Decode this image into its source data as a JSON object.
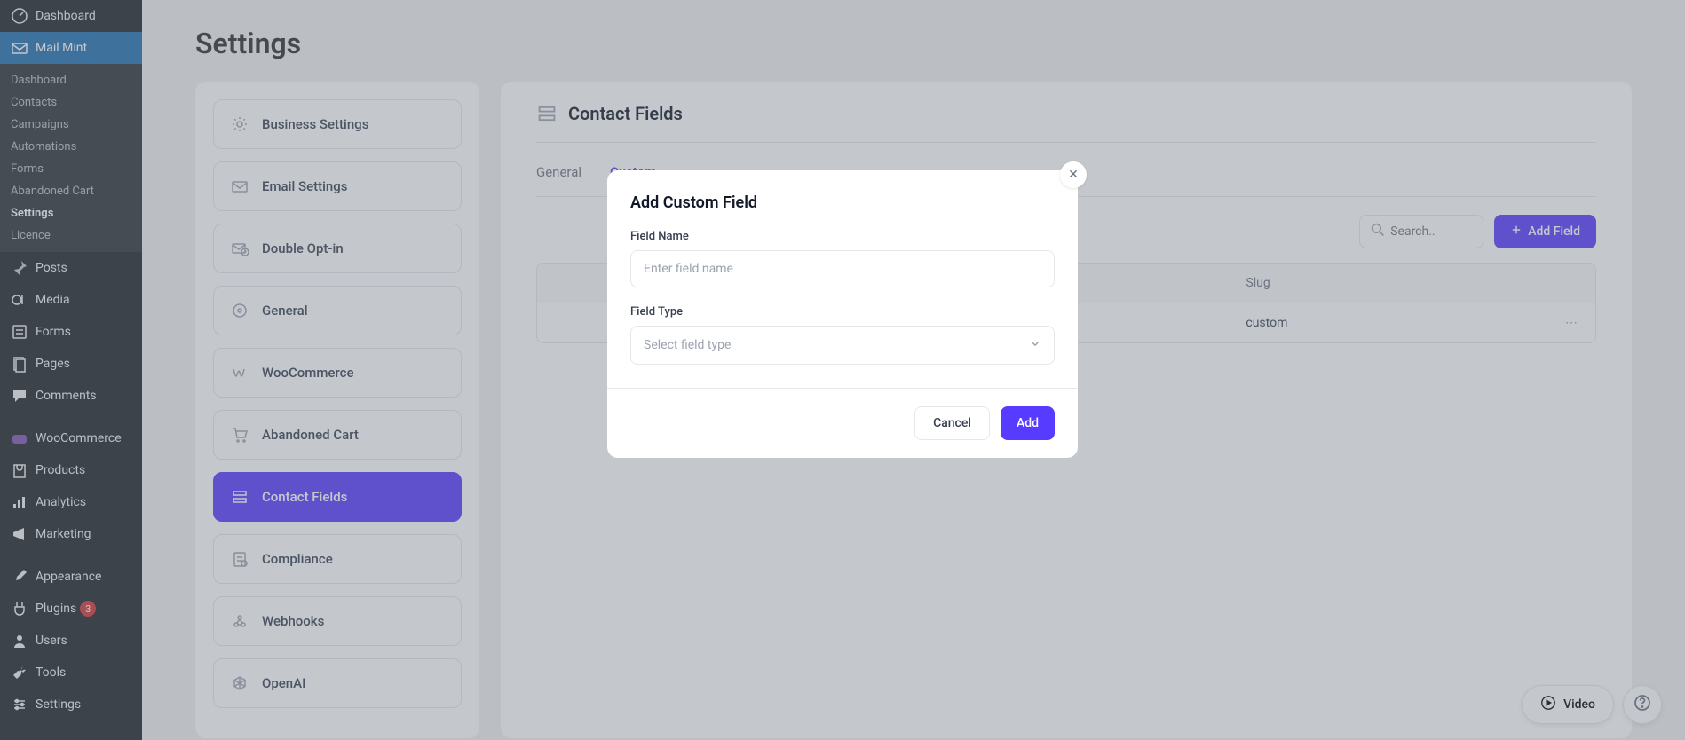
{
  "sidebar": {
    "main": [
      {
        "label": "Dashboard",
        "icon": "dashboard"
      },
      {
        "label": "Mail Mint",
        "icon": "mail",
        "active": true
      }
    ],
    "sub": [
      {
        "label": "Dashboard"
      },
      {
        "label": "Contacts"
      },
      {
        "label": "Campaigns"
      },
      {
        "label": "Automations"
      },
      {
        "label": "Forms"
      },
      {
        "label": "Abandoned Cart"
      },
      {
        "label": "Settings",
        "active": true
      },
      {
        "label": "Licence"
      }
    ],
    "bottom": [
      {
        "label": "Posts",
        "icon": "pin"
      },
      {
        "label": "Media",
        "icon": "media"
      },
      {
        "label": "Forms",
        "icon": "forms"
      },
      {
        "label": "Pages",
        "icon": "page"
      },
      {
        "label": "Comments",
        "icon": "comment"
      },
      {
        "label": "WooCommerce",
        "icon": "woo"
      },
      {
        "label": "Products",
        "icon": "product"
      },
      {
        "label": "Analytics",
        "icon": "analytics"
      },
      {
        "label": "Marketing",
        "icon": "marketing"
      },
      {
        "label": "Appearance",
        "icon": "brush"
      },
      {
        "label": "Plugins",
        "icon": "plugin",
        "badge": "3"
      },
      {
        "label": "Users",
        "icon": "user"
      },
      {
        "label": "Tools",
        "icon": "tool"
      },
      {
        "label": "Settings",
        "icon": "settings"
      }
    ]
  },
  "page": {
    "title": "Settings"
  },
  "settingsNav": [
    {
      "label": "Business Settings",
      "icon": "gear"
    },
    {
      "label": "Email Settings",
      "icon": "mail"
    },
    {
      "label": "Double Opt-in",
      "icon": "checkmail"
    },
    {
      "label": "General",
      "icon": "general"
    },
    {
      "label": "WooCommerce",
      "icon": "woo"
    },
    {
      "label": "Abandoned Cart",
      "icon": "cart"
    },
    {
      "label": "Contact Fields",
      "icon": "fields",
      "active": true
    },
    {
      "label": "Compliance",
      "icon": "compliance"
    },
    {
      "label": "Webhooks",
      "icon": "webhook"
    },
    {
      "label": "OpenAI",
      "icon": "openai"
    }
  ],
  "panel": {
    "title": "Contact Fields",
    "tabs": [
      {
        "label": "General"
      },
      {
        "label": "Custom",
        "active": true
      }
    ],
    "search_placeholder": "Search..",
    "add_button": "Add Field",
    "table": {
      "headers": {
        "slug": "Slug"
      },
      "rows": [
        {
          "slug": "custom"
        }
      ]
    }
  },
  "modal": {
    "title": "Add Custom Field",
    "field_name_label": "Field Name",
    "field_name_placeholder": "Enter field name",
    "field_type_label": "Field Type",
    "field_type_placeholder": "Select field type",
    "cancel": "Cancel",
    "add": "Add"
  },
  "floating": {
    "video": "Video"
  }
}
